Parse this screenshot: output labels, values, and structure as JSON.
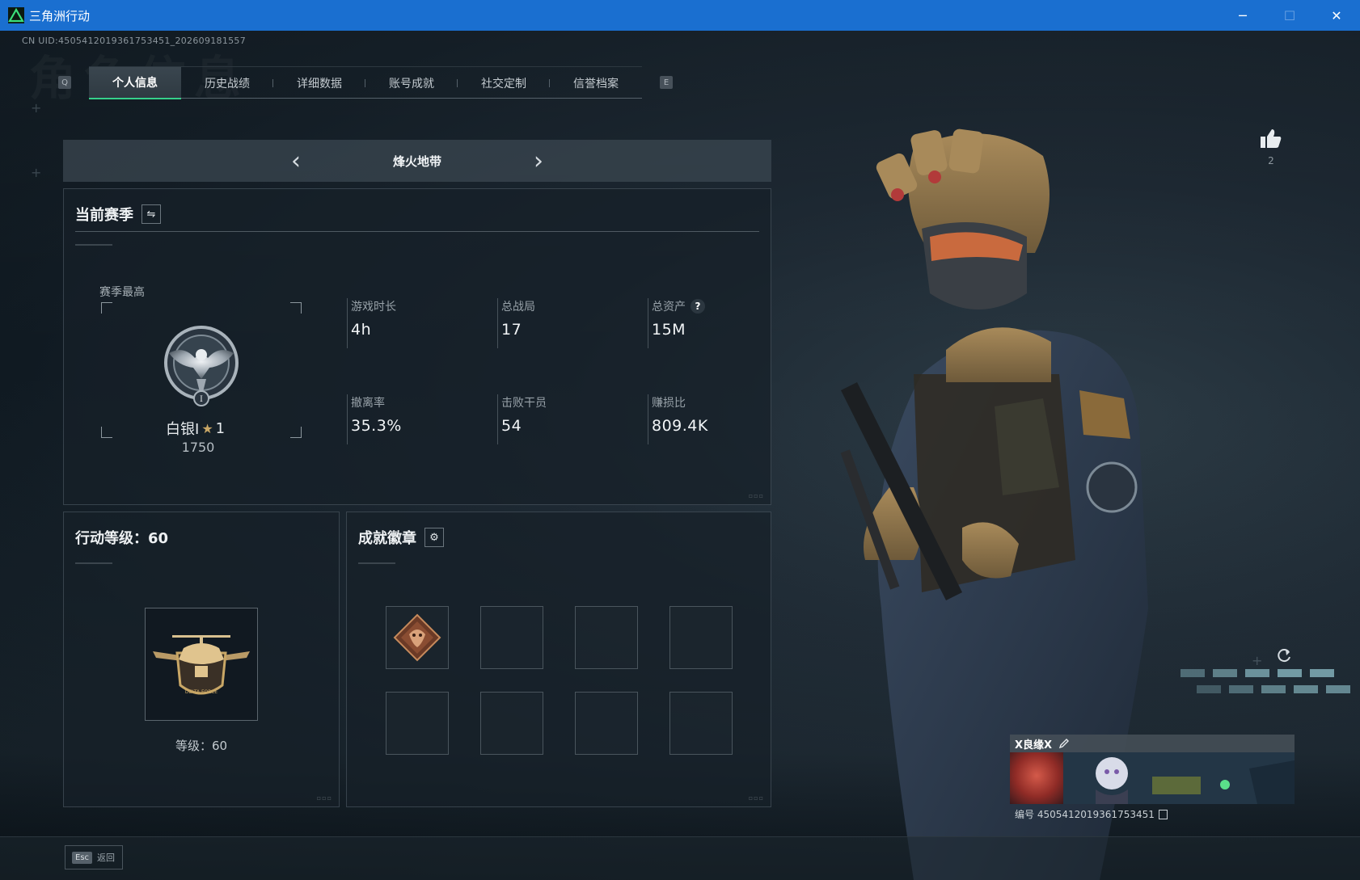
{
  "window": {
    "title": "三角洲行动",
    "controls": {
      "minimize": "─",
      "maximize": "☐",
      "close": "✕"
    }
  },
  "header": {
    "uid": "CN UID:4505412019361753451_202609181557",
    "watermark": "角色信息"
  },
  "tabs": {
    "left_key": "Q",
    "right_key": "E",
    "items": [
      {
        "label": "个人信息",
        "active": true
      },
      {
        "label": "历史战绩",
        "active": false
      },
      {
        "label": "详细数据",
        "active": false
      },
      {
        "label": "账号成就",
        "active": false
      },
      {
        "label": "社交定制",
        "active": false
      },
      {
        "label": "信誉档案",
        "active": false
      }
    ]
  },
  "mode": {
    "title": "烽火地带",
    "prev_icon": "chevron-left-icon",
    "next_icon": "chevron-right-icon"
  },
  "season": {
    "title": "当前赛季",
    "switch_icon": "swap-icon",
    "best_label": "赛季最高",
    "rank": {
      "tier": "白银I",
      "stars": "1",
      "points": "1750"
    },
    "stats": [
      {
        "label": "游戏时长",
        "value": "4h"
      },
      {
        "label": "总战局",
        "value": "17"
      },
      {
        "label": "总资产",
        "value": "15M",
        "help": "?"
      },
      {
        "label": "撤离率",
        "value": "35.3%"
      },
      {
        "label": "击败干员",
        "value": "54"
      },
      {
        "label": "赚损比",
        "value": "809.4K"
      }
    ]
  },
  "level": {
    "title": "行动等级：60",
    "level_text": "等级：60"
  },
  "achievements": {
    "title": "成就徽章",
    "settings_icon": "gear-icon",
    "slots": [
      {
        "filled": true
      },
      {
        "filled": false
      },
      {
        "filled": false
      },
      {
        "filled": false
      },
      {
        "filled": false
      },
      {
        "filled": false
      },
      {
        "filled": false
      },
      {
        "filled": false
      }
    ]
  },
  "profile": {
    "like_count": "2",
    "player_name": "X良缘X",
    "player_id": "编号 4505412019361753451"
  },
  "footer": {
    "esc_key": "Esc",
    "esc_label": "返回"
  },
  "colors": {
    "titlebar": "#1a6fd0",
    "accent": "#36d08a",
    "rank_star": "#c9a766"
  }
}
